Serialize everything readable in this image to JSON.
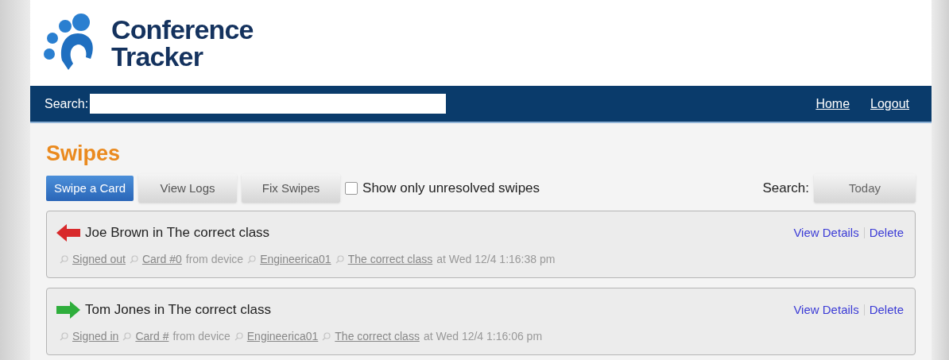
{
  "logo": {
    "line1": "Conference",
    "line2": "Tracker"
  },
  "nav": {
    "search_label": "Search:",
    "links": [
      "Home",
      "Logout"
    ]
  },
  "page_title": "Swipes",
  "toolbar": {
    "buttons": [
      {
        "label": "Swipe a Card",
        "selected": true
      },
      {
        "label": "View Logs",
        "selected": false
      },
      {
        "label": "Fix Swipes",
        "selected": false
      }
    ],
    "filter": {
      "label": "Show only unresolved swipes",
      "checked": false
    },
    "search_label": "Search:",
    "search_button": "Today"
  },
  "swipes": [
    {
      "kind": "out",
      "title": "Joe Brown in The correct class",
      "actions": [
        "View Details",
        "Delete"
      ],
      "details": [
        {
          "kind": "link",
          "text": "Signed out"
        },
        {
          "kind": "link",
          "text": "Card #0"
        },
        {
          "kind": "text",
          "text": "from device"
        },
        {
          "kind": "link",
          "text": "Engineerica01"
        },
        {
          "kind": "link",
          "text": "The correct class"
        },
        {
          "kind": "text",
          "text": "at Wed 12/4 1:16:38 pm"
        }
      ]
    },
    {
      "kind": "in",
      "title": "Tom Jones in The correct class",
      "actions": [
        "View Details",
        "Delete"
      ],
      "details": [
        {
          "kind": "link",
          "text": "Signed in"
        },
        {
          "kind": "link",
          "text": "Card #"
        },
        {
          "kind": "text",
          "text": "from device"
        },
        {
          "kind": "link",
          "text": "Engineerica01"
        },
        {
          "kind": "link",
          "text": "The correct class"
        },
        {
          "kind": "text",
          "text": "at Wed 12/4 1:16:06 pm"
        }
      ]
    }
  ]
}
